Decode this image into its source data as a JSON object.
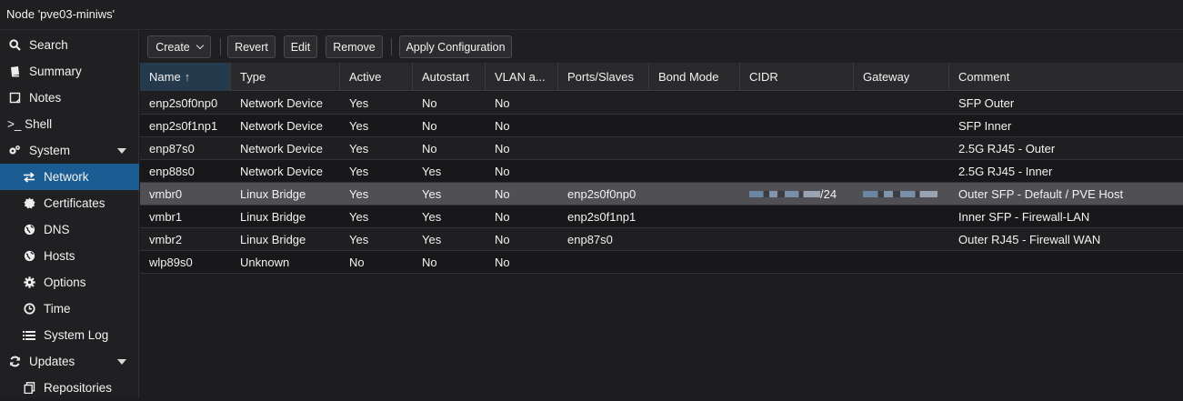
{
  "window": {
    "title": "Node 'pve03-miniws'"
  },
  "sidebar": {
    "items": [
      {
        "label": "Search",
        "icon": "search-icon"
      },
      {
        "label": "Summary",
        "icon": "book-icon"
      },
      {
        "label": "Notes",
        "icon": "note-icon"
      },
      {
        "label": ">_ Shell",
        "icon": "terminal-icon"
      },
      {
        "label": "System",
        "icon": "cogs-icon"
      },
      {
        "label": "Network",
        "icon": "exchange-icon",
        "selected": true
      },
      {
        "label": "Certificates",
        "icon": "certificate-icon"
      },
      {
        "label": "DNS",
        "icon": "globe-icon"
      },
      {
        "label": "Hosts",
        "icon": "globe-icon"
      },
      {
        "label": "Options",
        "icon": "gear-icon"
      },
      {
        "label": "Time",
        "icon": "clock-icon"
      },
      {
        "label": "System Log",
        "icon": "list-icon"
      },
      {
        "label": "Updates",
        "icon": "refresh-icon"
      },
      {
        "label": "Repositories",
        "icon": "files-icon"
      }
    ]
  },
  "toolbar": {
    "create": "Create",
    "revert": "Revert",
    "edit": "Edit",
    "remove": "Remove",
    "apply": "Apply Configuration"
  },
  "grid": {
    "columns": [
      "Name",
      "Type",
      "Active",
      "Autostart",
      "VLAN a...",
      "Ports/Slaves",
      "Bond Mode",
      "CIDR",
      "Gateway",
      "Comment"
    ],
    "sort_indicator": "↑",
    "rows": [
      {
        "name": "enp2s0f0np0",
        "type": "Network Device",
        "active": "Yes",
        "autostart": "No",
        "vlan": "No",
        "ports": "",
        "bond": "",
        "cidr": "",
        "gateway": "",
        "comment": "SFP Outer"
      },
      {
        "name": "enp2s0f1np1",
        "type": "Network Device",
        "active": "Yes",
        "autostart": "No",
        "vlan": "No",
        "ports": "",
        "bond": "",
        "cidr": "",
        "gateway": "",
        "comment": "SFP Inner"
      },
      {
        "name": "enp87s0",
        "type": "Network Device",
        "active": "Yes",
        "autostart": "No",
        "vlan": "No",
        "ports": "",
        "bond": "",
        "cidr": "",
        "gateway": "",
        "comment": "2.5G RJ45 - Outer"
      },
      {
        "name": "enp88s0",
        "type": "Network Device",
        "active": "Yes",
        "autostart": "Yes",
        "vlan": "No",
        "ports": "",
        "bond": "",
        "cidr": "",
        "gateway": "",
        "comment": "2.5G RJ45 - Inner"
      },
      {
        "name": "vmbr0",
        "type": "Linux Bridge",
        "active": "Yes",
        "autostart": "Yes",
        "vlan": "No",
        "ports": "enp2s0f0np0",
        "bond": "",
        "cidr": "/24",
        "gateway": "",
        "comment": "Outer SFP - Default / PVE Host",
        "selected": true
      },
      {
        "name": "vmbr1",
        "type": "Linux Bridge",
        "active": "Yes",
        "autostart": "Yes",
        "vlan": "No",
        "ports": "enp2s0f1np1",
        "bond": "",
        "cidr": "",
        "gateway": "",
        "comment": "Inner SFP - Firewall-LAN"
      },
      {
        "name": "vmbr2",
        "type": "Linux Bridge",
        "active": "Yes",
        "autostart": "Yes",
        "vlan": "No",
        "ports": "enp87s0",
        "bond": "",
        "cidr": "",
        "gateway": "",
        "comment": "Outer RJ45 - Firewall WAN"
      },
      {
        "name": "wlp89s0",
        "type": "Unknown",
        "active": "No",
        "autostart": "No",
        "vlan": "No",
        "ports": "",
        "bond": "",
        "cidr": "",
        "gateway": "",
        "comment": ""
      }
    ]
  }
}
